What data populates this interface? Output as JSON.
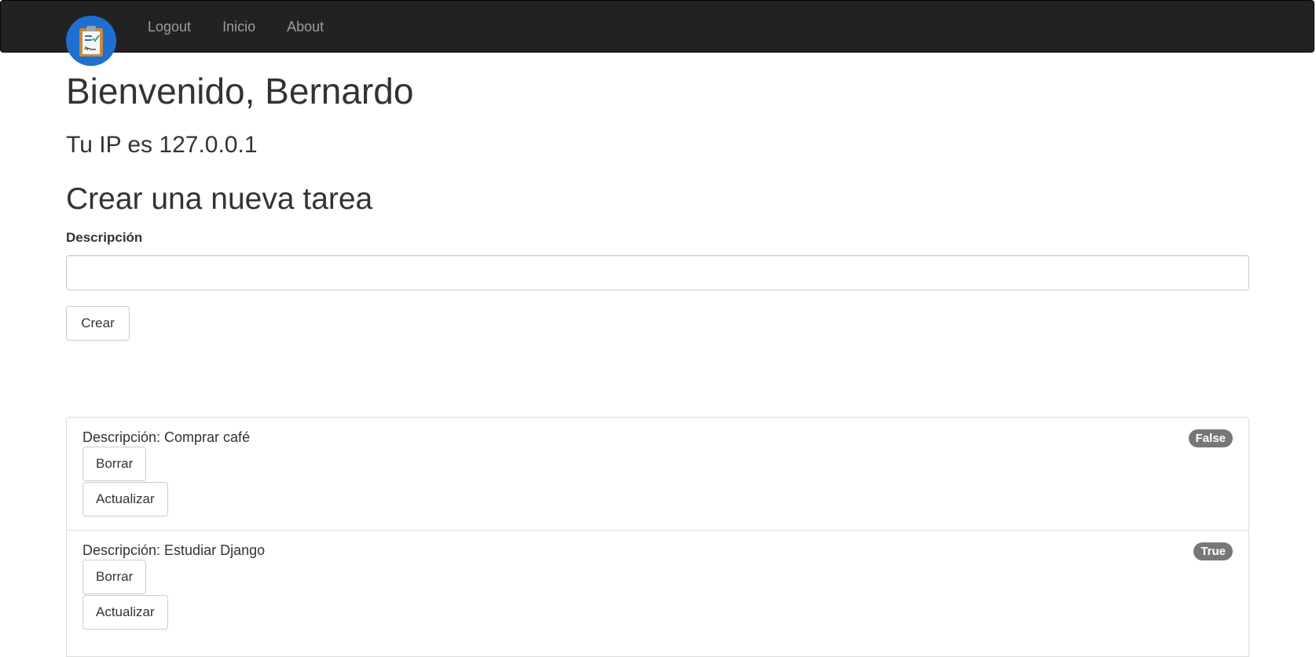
{
  "nav": {
    "logo_icon": "clipboard-check-icon",
    "links": [
      "Logout",
      "Inicio",
      "About"
    ]
  },
  "welcome": "Bienvenido, Bernardo",
  "ip_text": "Tu IP es 127.0.0.1",
  "form": {
    "title": "Crear una nueva tarea",
    "label": "Descripción",
    "value": "",
    "submit_label": "Crear"
  },
  "tasks": [
    {
      "description": "Descripción: Comprar café",
      "status": "False",
      "delete_label": "Borrar",
      "update_label": "Actualizar"
    },
    {
      "description": "Descripción: Estudiar Django",
      "status": "True",
      "delete_label": "Borrar",
      "update_label": "Actualizar"
    }
  ],
  "colors": {
    "navbar_bg": "#222222",
    "nav_link": "#9d9d9d",
    "logo_bg": "#1e6fcf",
    "badge_bg": "#777777"
  }
}
